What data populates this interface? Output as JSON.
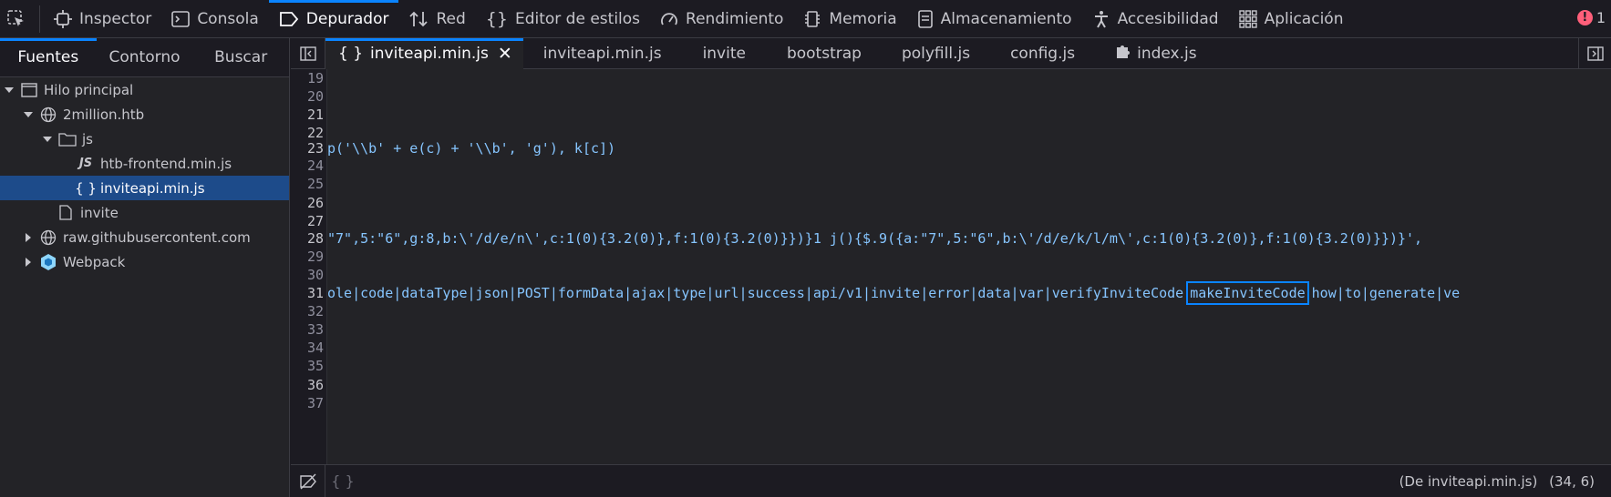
{
  "toolbar": {
    "tabs": [
      {
        "label": "Inspector",
        "icon": "inspector-icon"
      },
      {
        "label": "Consola",
        "icon": "console-icon"
      },
      {
        "label": "Depurador",
        "icon": "debugger-icon"
      },
      {
        "label": "Red",
        "icon": "network-icon"
      },
      {
        "label": "Editor de estilos",
        "icon": "style-editor-icon"
      },
      {
        "label": "Rendimiento",
        "icon": "performance-icon"
      },
      {
        "label": "Memoria",
        "icon": "memory-icon"
      },
      {
        "label": "Almacenamiento",
        "icon": "storage-icon"
      },
      {
        "label": "Accesibilidad",
        "icon": "accessibility-icon"
      },
      {
        "label": "Aplicación",
        "icon": "application-icon"
      }
    ],
    "selected_tab": "Depurador",
    "error_count": "1"
  },
  "left_pane": {
    "tabs": [
      "Fuentes",
      "Contorno",
      "Buscar"
    ],
    "selected_tab": "Fuentes",
    "tree": {
      "thread": "Hilo principal",
      "domain1": "2million.htb",
      "folder": "js",
      "file1": "htb-frontend.min.js",
      "file2": "inviteapi.min.js",
      "file3": "invite",
      "domain2": "raw.githubusercontent.com",
      "webpack": "Webpack"
    }
  },
  "editor": {
    "tabs": [
      {
        "label": "inviteapi.min.js",
        "active": true
      },
      {
        "label": "inviteapi.min.js"
      },
      {
        "label": "invite"
      },
      {
        "label": "bootstrap"
      },
      {
        "label": "polyfill.js"
      },
      {
        "label": "config.js"
      },
      {
        "label": "index.js"
      }
    ],
    "active_tab_prefix": "{ }",
    "lines": [
      {
        "n": "19",
        "text": ""
      },
      {
        "n": "20",
        "text": ""
      },
      {
        "n": "21",
        "text": ""
      },
      {
        "n": "22",
        "text": ""
      },
      {
        "n": "23",
        "text": "p('\\\\b' + e(c) + '\\\\b', 'g'), k[c])"
      },
      {
        "n": "24",
        "text": ""
      },
      {
        "n": "25",
        "text": ""
      },
      {
        "n": "26",
        "text": ""
      },
      {
        "n": "27",
        "text": ""
      },
      {
        "n": "28",
        "text": "\"7\",5:\"6\",g:8,b:\\'/d/e/n\\',c:1(0){3.2(0)},f:1(0){3.2(0)}})}1 j(){$.9({a:\"7\",5:\"6\",b:\\'/d/e/k/l/m\\',c:1(0){3.2(0)},f:1(0){3.2(0)}})}',"
      },
      {
        "n": "29",
        "text": ""
      },
      {
        "n": "30",
        "text": ""
      },
      {
        "n": "31",
        "text_before": "ole|code|dataType|json|POST|formData|ajax|type|url|success|api/v1|invite|error|data|var|verifyInviteCode",
        "highlight": "makeInviteCode",
        "text_after": "how|to|generate|ve"
      },
      {
        "n": "32",
        "text": ""
      },
      {
        "n": "33",
        "text": ""
      },
      {
        "n": "34",
        "text": ""
      },
      {
        "n": "35",
        "text": ""
      },
      {
        "n": "36",
        "text": ""
      },
      {
        "n": "37",
        "text": ""
      }
    ]
  },
  "status_bar": {
    "pretty_print": "{ }",
    "source_info": "(De inviteapi.min.js)",
    "cursor": "(34, 6)"
  }
}
